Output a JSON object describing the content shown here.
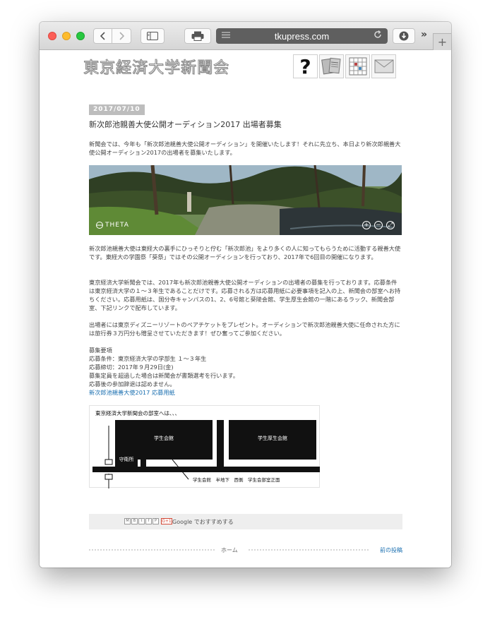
{
  "browser": {
    "url": "tkupress.com",
    "overflow_chevron": "»",
    "new_tab": "+"
  },
  "site": {
    "logo_text": "東京経済大学新聞会",
    "header_icons": [
      "question-icon",
      "newspaper-icon",
      "calendar-grid-icon",
      "mail-icon"
    ],
    "question_glyph": "?"
  },
  "post": {
    "date": "2017/07/10",
    "title": "新次郎池親善大使公開オーディション2017 出場者募集",
    "intro": "新聞会では、今年も「新次郎池親善大使公開オーディション」を開催いたします！それに先立ち、本日より新次郎親善大使公開オーディション2017の出場者を募集いたします。",
    "panorama": {
      "label": "THETA"
    },
    "body1": "新次郎池親善大使は東経大の裏手にひっそりと佇む「新次郎池」をより多くの人に知ってもらうために活動する親善大使です。東経大の学園祭「葵祭」ではその公開オーディションを行っており、2017年で6回目の開催になります。",
    "body2": "東京経済大学新聞会では、2017年も新次郎池親善大使公開オーディションの出場者の募集を行っております。応募条件は東京経済大学の１～３年生であることだけです。応募される方は応募用紙に必要事項を記入の上、新聞会の部室へお持ちください。応募用紙は、国分寺キャンパスの1、2、6号館と葵陵会館、学生厚生会館の一階にあるラック、新聞会部室、下記リンクで配布しています。",
    "body3": "出場者には東京ディズニーリゾートのペアチケットをプレゼント。オーディションで新次郎池親善大使に任命された方には旅行券３万円分も贈呈させていただきます！ぜひ奮ってご参加ください。",
    "requirements": {
      "heading": "募集要項",
      "items": [
        "応募条件：東京経済大学の学部生 １～３年生",
        "応募締切：2017年９月29日(金)",
        "募集定員を超過した場合は新聞会が書類選考を行います。",
        "応募後の参加辞退は認めません。"
      ],
      "link": "新次郎池親善大使2017 応募用紙"
    },
    "map": {
      "caption": "東京経済大学新聞会の部室へは、、、",
      "building_left": "学生会館",
      "building_right": "学生厚生会館",
      "guard": "守衛所",
      "pointer": "学生会館　半地下　西側　学生会部室正面"
    }
  },
  "share": {
    "icons": [
      "M",
      "B",
      "t",
      "f",
      "P"
    ],
    "gplus": "G+1",
    "text": "Google でおすすめする"
  },
  "footer": {
    "home": "ホーム",
    "next": "前の投稿"
  }
}
